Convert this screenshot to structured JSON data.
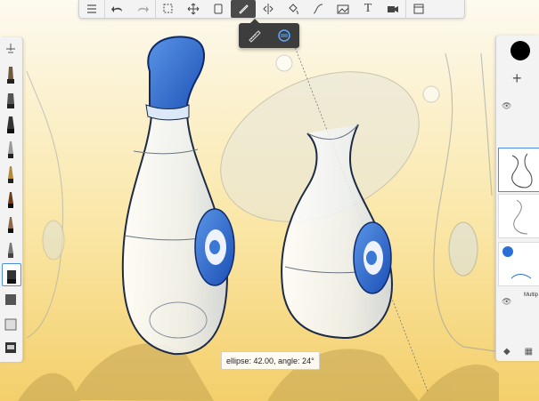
{
  "toolbar": {
    "tools": [
      {
        "name": "list-icon"
      },
      {
        "name": "undo-icon"
      },
      {
        "name": "redo-icon"
      },
      {
        "name": "select-icon"
      },
      {
        "name": "transform-icon"
      },
      {
        "name": "copy-icon"
      },
      {
        "name": "ruler-icon",
        "active": true
      },
      {
        "name": "symmetry-icon"
      },
      {
        "name": "fill-icon"
      },
      {
        "name": "curve-icon"
      },
      {
        "name": "image-icon"
      },
      {
        "name": "text-icon"
      },
      {
        "name": "video-icon"
      },
      {
        "name": "window-icon"
      }
    ],
    "text_glyph": "T"
  },
  "ruler_popup": {
    "straight": "ruler-straight-icon",
    "ellipse": "ellipse-guide-icon"
  },
  "status": {
    "text": "ellipse: 42.00, angle: 24°"
  },
  "layers": {
    "color": "#000000",
    "add_label": "+",
    "blend_label": "Multip"
  },
  "colors": {
    "accent": "#2a6fd6",
    "selection": "#4a90e2",
    "canvas_bg": "#fbf6e8"
  }
}
